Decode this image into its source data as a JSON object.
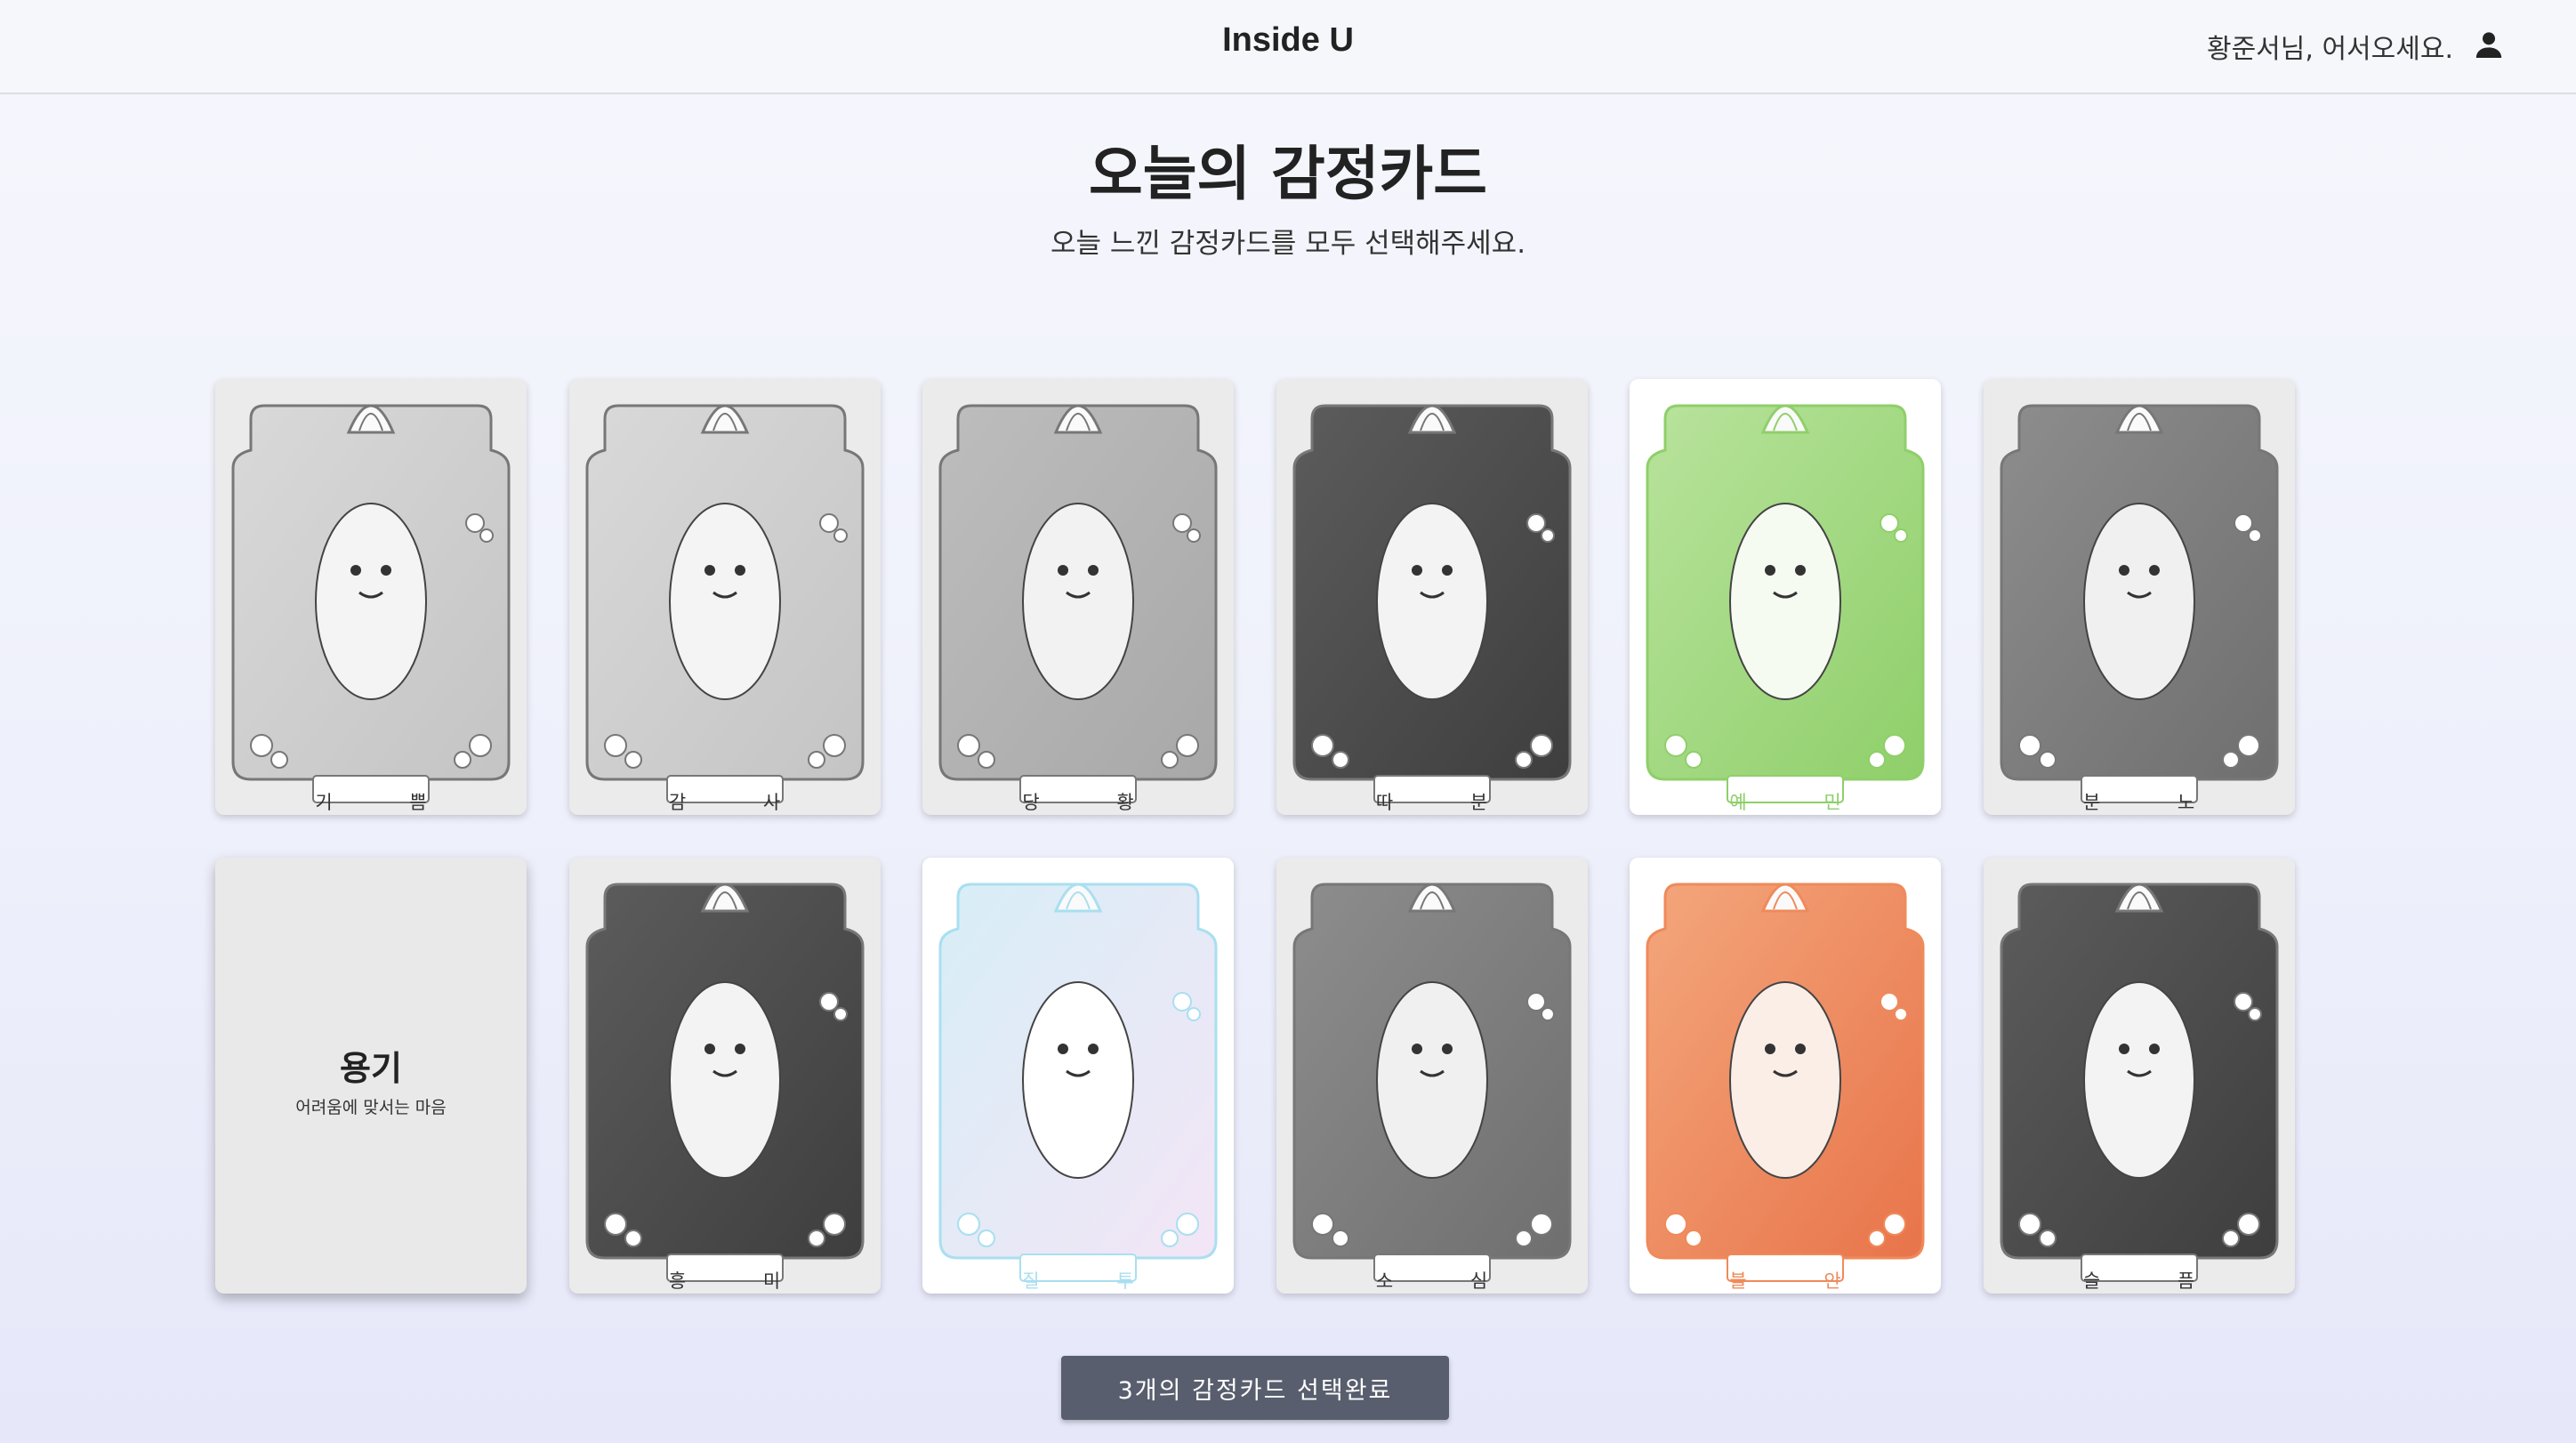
{
  "header": {
    "brand": "Inside U",
    "greeting": "황준서님, 어서오세요.",
    "user_icon": "person-icon"
  },
  "page": {
    "title": "오늘의 감정카드",
    "subtitle": "오늘 느낀 감정카드를 모두 선택해주세요."
  },
  "cards": [
    {
      "name": "기쁨",
      "label": "기  쁨",
      "tone": "light-gray"
    },
    {
      "name": "감사",
      "label": "감  사",
      "tone": "light-gray"
    },
    {
      "name": "당황",
      "label": "당  황",
      "tone": "gray"
    },
    {
      "name": "따분",
      "label": "따  분",
      "tone": "dark"
    },
    {
      "name": "예민",
      "label": "예  민",
      "tone": "green",
      "accent": "#8fcf6a",
      "selected": true
    },
    {
      "name": "분노",
      "label": "분  노",
      "tone": "dark-gray"
    },
    {
      "name": "용기",
      "flipped": true,
      "back_title": "용기",
      "back_desc": "어려움에 맞서는 마음"
    },
    {
      "name": "흥미",
      "label": "흥  미",
      "tone": "dark"
    },
    {
      "name": "질투",
      "label": "질  투",
      "tone": "pastel",
      "accent": "#a9dff0",
      "selected": true
    },
    {
      "name": "소심",
      "label": "소  심",
      "tone": "dark-gray"
    },
    {
      "name": "불안",
      "label": "불  안",
      "tone": "orange",
      "accent": "#ef8a5a",
      "selected": true
    },
    {
      "name": "슬픔",
      "label": "슬  픔",
      "tone": "dark"
    }
  ],
  "confirm_button": {
    "label": "3개의 감정카드 선택완료"
  },
  "colors": {
    "button_bg": "#595e6e",
    "background": "#eef0fb"
  }
}
